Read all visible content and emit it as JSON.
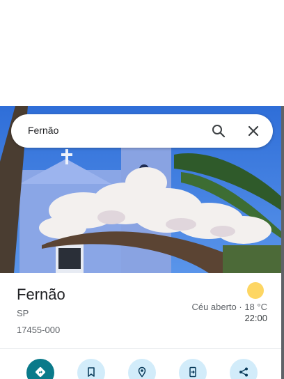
{
  "search": {
    "value": "Fernão",
    "search_icon": "search-icon",
    "close_icon": "close-icon"
  },
  "place": {
    "title": "Fernão",
    "state": "SP",
    "postal_code": "17455-000"
  },
  "weather": {
    "icon": "sun-icon",
    "condition": "Céu aberto · 18 °C",
    "time": "22:00"
  },
  "actions": [
    {
      "icon": "directions-icon"
    },
    {
      "icon": "bookmark-icon"
    },
    {
      "icon": "explore-icon"
    },
    {
      "icon": "send-to-device-icon"
    },
    {
      "icon": "share-icon"
    }
  ],
  "colors": {
    "primary_action": "#0b7a8a",
    "secondary_action": "#d2ecfa",
    "weather_sun": "#fdd663"
  }
}
